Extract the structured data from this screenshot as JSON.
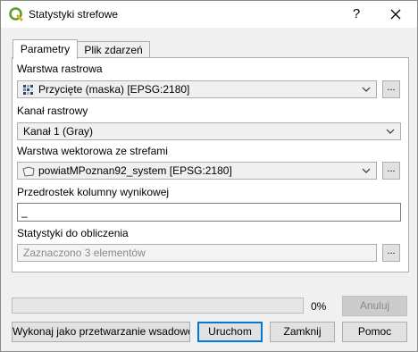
{
  "window": {
    "title": "Statystyki strefowe",
    "help": "?",
    "close": "✕"
  },
  "tabs": [
    {
      "label": "Parametry"
    },
    {
      "label": "Plik zdarzeń"
    }
  ],
  "form": {
    "raster_layer": {
      "label": "Warstwa rastrowa",
      "value": "Przycięte (maska) [EPSG:2180]"
    },
    "raster_band": {
      "label": "Kanał rastrowy",
      "value": "Kanał 1 (Gray)"
    },
    "vector_layer": {
      "label": "Warstwa wektorowa ze strefami",
      "value": "powiatMPoznan92_system [EPSG:2180]"
    },
    "prefix": {
      "label": "Przedrostek kolumny wynikowej",
      "value": "_"
    },
    "stats": {
      "label": "Statystyki do obliczenia",
      "value": "Zaznaczono 3 elementów"
    },
    "browse": "..."
  },
  "progress": {
    "percent_label": "0%",
    "value": 0
  },
  "buttons": {
    "cancel": "Anuluj",
    "batch": "Wykonaj jako przetwarzanie wsadowe...",
    "run": "Uruchom",
    "close": "Zamknij",
    "help": "Pomoc"
  }
}
